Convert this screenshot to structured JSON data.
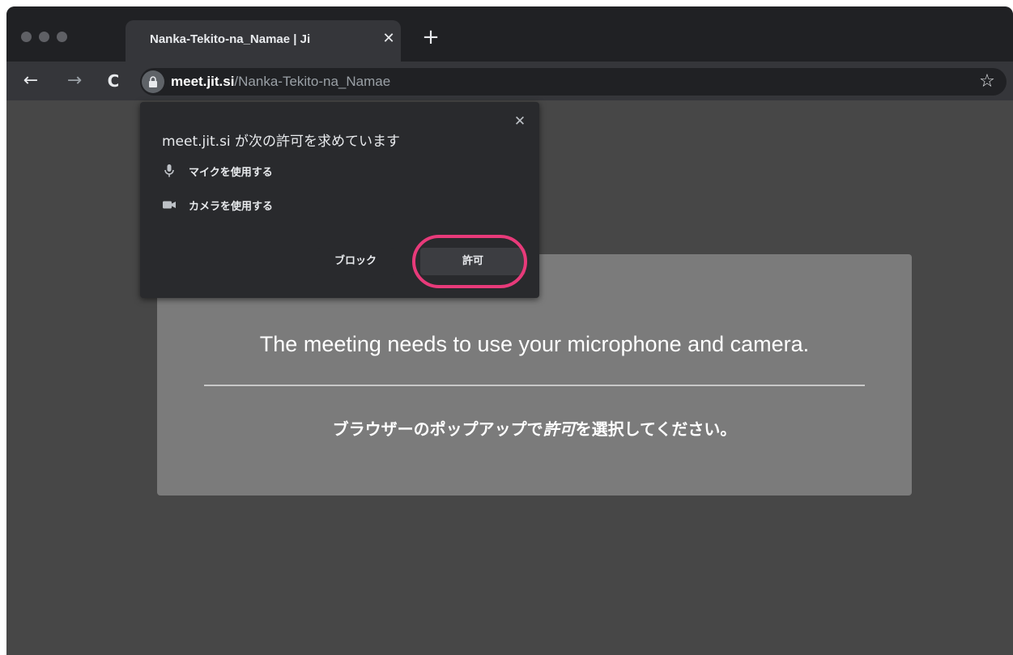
{
  "browser": {
    "tab": {
      "title": "Nanka-Tekito-na_Namae | Ji",
      "close_glyph": "✕"
    },
    "new_tab_glyph": "+",
    "nav": {
      "back_glyph": "←",
      "forward_glyph": "→",
      "reload_glyph": "C"
    },
    "address": {
      "host": "meet.jit.si",
      "path": "/Nanka-Tekito-na_Namae"
    },
    "bookmark_glyph": "☆"
  },
  "permission_popup": {
    "title": "meet.jit.si が次の許可を求めています",
    "close_glyph": "✕",
    "permissions": [
      {
        "icon": "microphone-icon",
        "label": "マイクを使用する"
      },
      {
        "icon": "camera-icon",
        "label": "カメラを使用する"
      }
    ],
    "block_label": "ブロック",
    "allow_label": "許可"
  },
  "notice": {
    "headline": "The meeting needs to use your microphone and camera.",
    "instruction_before": "ブラウザーのポップアップで",
    "instruction_emphasis": "許可",
    "instruction_after": "を選択してください。"
  },
  "colors": {
    "highlight": "#e83a7a",
    "page_background": "#474747",
    "notice_background": "#7b7b7b",
    "popup_background": "#292a2d"
  }
}
